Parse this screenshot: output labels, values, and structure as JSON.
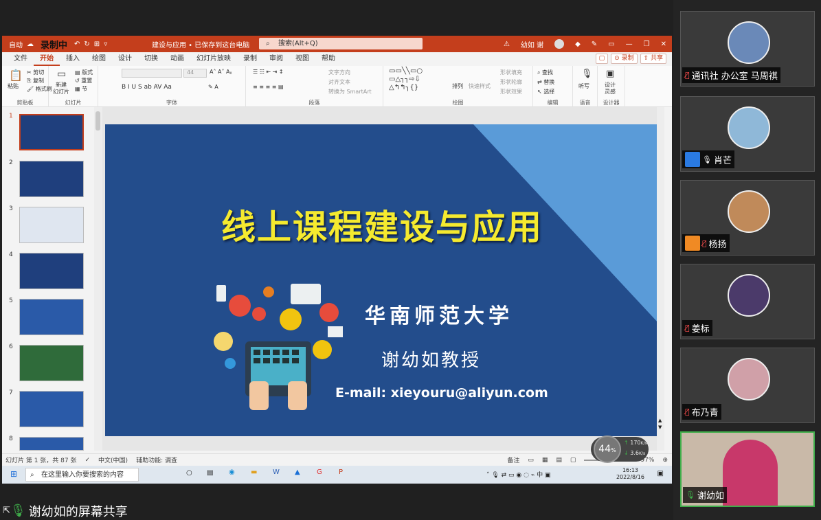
{
  "ppt": {
    "autosave": "自动",
    "recording": "录制中",
    "file_name": "建设与应用 • 已保存到这台电脑",
    "search_placeholder": "搜索(Alt+Q)",
    "user": "幼如 谢",
    "menus": [
      "文件",
      "开始",
      "插入",
      "绘图",
      "设计",
      "切换",
      "动画",
      "幻灯片放映",
      "录制",
      "审阅",
      "视图",
      "帮助"
    ],
    "record_btn": "录制",
    "share_btn": "共享",
    "ribbon": {
      "clipboard": {
        "paste": "粘贴",
        "cut": "剪切",
        "copy": "复制",
        "format_painter": "格式刷",
        "label": "剪贴板"
      },
      "slides": {
        "new": "新建",
        "new2": "幻灯片",
        "layout": "版式",
        "reset": "重置",
        "section": "节",
        "label": "幻灯片"
      },
      "font": {
        "size": "44",
        "label": "字体"
      },
      "paragraph": {
        "text_direction": "文字方向",
        "align_text": "对齐文本",
        "smartart": "转换为 SmartArt",
        "label": "段落"
      },
      "drawing": {
        "arrange": "排列",
        "quick_styles": "快速样式",
        "fill": "形状填充",
        "outline": "形状轮廓",
        "effects": "形状效果",
        "label": "绘图"
      },
      "editing": {
        "find": "查找",
        "replace": "替换",
        "select": "选择",
        "label": "编辑"
      },
      "voice": {
        "dictate": "听写",
        "label": "语音"
      },
      "designer": {
        "design": "设计",
        "ideas": "灵感",
        "label": "设计器"
      }
    },
    "slide": {
      "title": "线上课程建设与应用",
      "university": "华南师范大学",
      "professor": "谢幼如教授",
      "email": "E-mail: xieyouru@aliyun.com"
    },
    "thumbnails": [
      "1",
      "2",
      "3",
      "4",
      "5",
      "6",
      "7",
      "8"
    ],
    "statusbar": {
      "slide_info": "幻灯片 第 1 张，共 87 张",
      "language": "中文(中国)",
      "accessibility": "辅助功能: 调查",
      "notes": "备注",
      "zoom": "97%"
    }
  },
  "taskbar": {
    "search_placeholder": "在这里输入你要搜索的内容",
    "time": "16:13",
    "date": "2022/8/16"
  },
  "network": {
    "percent": "44",
    "percent_unit": "%",
    "up": "170",
    "up_unit": "K/s",
    "down": "3.6",
    "down_unit": "K/s"
  },
  "share_label": "谢幼如的屏幕共享",
  "participants": [
    {
      "name": "通讯社 办公室 马周祺",
      "muted": true
    },
    {
      "name": "肖芒",
      "muted": false
    },
    {
      "name": "杨扬",
      "muted": true
    },
    {
      "name": "姜标",
      "muted": true
    },
    {
      "name": "布乃青",
      "muted": true
    },
    {
      "name": "谢幼如",
      "muted": false,
      "speaking": true
    }
  ],
  "colors": {
    "ppt_accent": "#c43e1c",
    "slide_bg": "#234d8c",
    "title_yellow": "#f5ea2f",
    "speaking_border": "#3fae4a"
  }
}
